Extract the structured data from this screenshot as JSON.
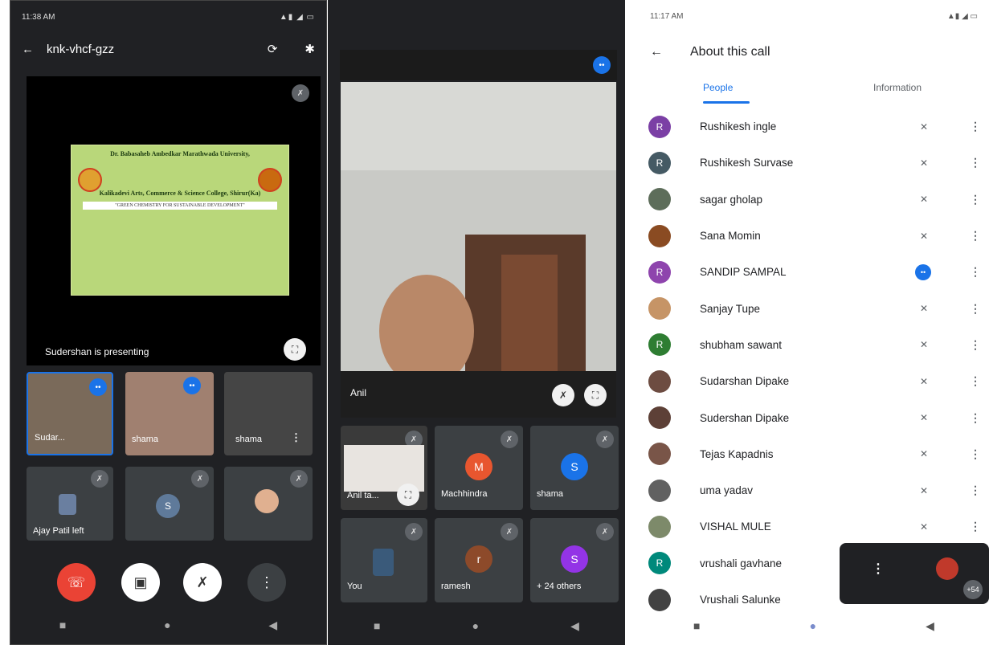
{
  "phone1": {
    "status": {
      "time": "11:38 AM",
      "right": "▲▮ ◢ ▭"
    },
    "meeting_code": "knk-vhcf-gzz",
    "slide": {
      "line1": "Dr. Babasaheb Ambedkar Marathwada University,",
      "line2": "Kalikadevi Arts, Commerce & Science College, Shirur(Ka)",
      "line3": "\"GREEN CHEMISTRY FOR SUSTAINABLE DEVELOPMENT\""
    },
    "presenting_label": "Sudershan is presenting",
    "tiles": [
      {
        "name": "Sudar..."
      },
      {
        "name": "shama"
      },
      {
        "name": "shama"
      },
      {
        "name": "Ajay Patil left"
      }
    ],
    "avatar_letter": "S"
  },
  "phone2": {
    "main_name": "Anil",
    "tiles": [
      {
        "name": "Anil ta...",
        "letter": ""
      },
      {
        "name": "Machhindra",
        "letter": "M",
        "color": "#e8562f"
      },
      {
        "name": "shama",
        "letter": "S",
        "color": "#1a73e8"
      },
      {
        "name": "You",
        "letter": ""
      },
      {
        "name": "ramesh",
        "letter": "r",
        "color": "#8d4a2a"
      },
      {
        "name": "+ 24 others",
        "letter": "S",
        "color": "#9334e6"
      }
    ]
  },
  "phone3": {
    "status": {
      "time": "11:17 AM"
    },
    "title": "About this call",
    "tabs": [
      "People",
      "Information"
    ],
    "people": [
      {
        "name": "Rushikesh ingle",
        "letter": "R",
        "color": "#7b3fa5",
        "speaking": false
      },
      {
        "name": "Rushikesh Survase",
        "letter": "R",
        "color": "#455a64",
        "speaking": false
      },
      {
        "name": "sagar gholap",
        "letter": "",
        "color": "#5d6d5a",
        "speaking": false
      },
      {
        "name": "Sana Momin",
        "letter": "",
        "color": "#8a4b22",
        "speaking": false
      },
      {
        "name": "SANDIP SAMPAL",
        "letter": "R",
        "color": "#8e44ad",
        "speaking": true
      },
      {
        "name": "Sanjay Tupe",
        "letter": "",
        "color": "#c69466",
        "speaking": false
      },
      {
        "name": "shubham sawant",
        "letter": "R",
        "color": "#2e7d32",
        "speaking": false
      },
      {
        "name": "Sudarshan Dipake",
        "letter": "",
        "color": "#6d4c41",
        "speaking": false
      },
      {
        "name": "Sudershan Dipake",
        "letter": "",
        "color": "#5d4037",
        "speaking": false
      },
      {
        "name": "Tejas Kapadnis",
        "letter": "",
        "color": "#795548",
        "speaking": false
      },
      {
        "name": "uma yadav",
        "letter": "",
        "color": "#616161",
        "speaking": false
      },
      {
        "name": "VISHAL MULE",
        "letter": "",
        "color": "#7d8a6a",
        "speaking": false
      },
      {
        "name": "vrushali gavhane",
        "letter": "R",
        "color": "#00897b",
        "speaking": false
      },
      {
        "name": "Vrushali Salunke",
        "letter": "",
        "color": "#424242",
        "speaking": false
      }
    ],
    "pip_count": "+54"
  }
}
